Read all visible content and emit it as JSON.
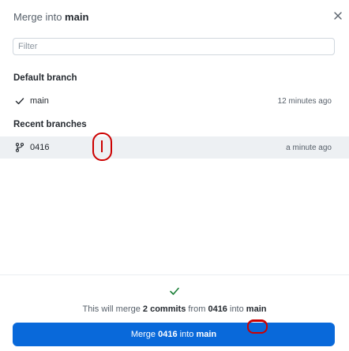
{
  "header": {
    "title_prefix": "Merge into ",
    "branch": "main"
  },
  "filter": {
    "placeholder": "Filter",
    "value": ""
  },
  "default_section": {
    "label": "Default branch",
    "items": [
      {
        "name": "main",
        "time": "12 minutes ago",
        "icon": "check-icon"
      }
    ]
  },
  "recent_section": {
    "label": "Recent branches",
    "items": [
      {
        "name": "0416",
        "time": "a minute ago",
        "icon": "branch-icon",
        "selected": true
      }
    ]
  },
  "status": {
    "icon": "check-icon",
    "prefix": "This will merge ",
    "commits": "2 commits",
    "from_word": " from ",
    "source": "0416",
    "into_word": " into ",
    "target": "main"
  },
  "merge_button": {
    "prefix": "Merge ",
    "source": "0416",
    "middle": " into ",
    "target": "main"
  },
  "colors": {
    "primary_button": "#0969da",
    "success": "#1a7f37",
    "annotation": "#cc0000"
  }
}
